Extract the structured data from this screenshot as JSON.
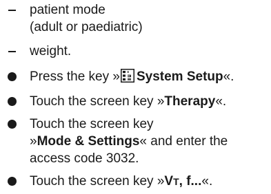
{
  "items": [
    {
      "marker": "dash",
      "lines": [
        "patient mode",
        "(adult or paediatric)"
      ]
    },
    {
      "marker": "dash",
      "text": "weight."
    },
    {
      "marker": "bullet",
      "pre": "Press the key »",
      "icon": "system-setup-key-icon",
      "bold": "System Setup",
      "post": "«."
    },
    {
      "marker": "bullet",
      "pre": "Touch the screen key »",
      "bold": "Therapy",
      "post": "«."
    },
    {
      "marker": "bullet",
      "line1": "Touch the screen key",
      "line2_pre": "»",
      "line2_bold": "Mode & Settings",
      "line2_post": "« and enter the",
      "line3": "access code 3032."
    },
    {
      "marker": "bullet",
      "pre": "Touch the screen key »",
      "bold_v": "V",
      "bold_t": "T",
      "bold_rest": ", f...",
      "post": "«."
    }
  ]
}
